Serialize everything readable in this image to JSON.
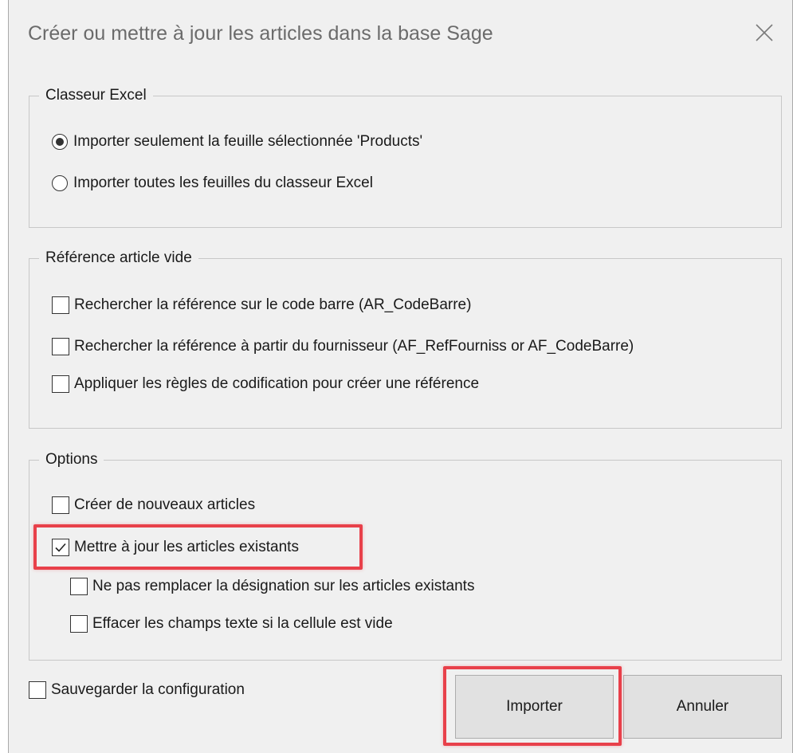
{
  "dialog": {
    "title": "Créer ou mettre à jour les articles dans la base Sage",
    "close_icon": "close-icon"
  },
  "classeur": {
    "legend": "Classeur Excel",
    "options": [
      {
        "label": "Importer seulement la feuille sélectionnée 'Products'",
        "checked": true
      },
      {
        "label": "Importer toutes les feuilles du classeur Excel",
        "checked": false
      }
    ]
  },
  "reference": {
    "legend": "Référence article vide",
    "options": [
      {
        "label": "Rechercher la référence sur le code barre (AR_CodeBarre)",
        "checked": false
      },
      {
        "label": "Rechercher la référence à partir du fournisseur (AF_RefFourniss or AF_CodeBarre)",
        "checked": false
      },
      {
        "label": "Appliquer les règles de codification pour créer une référence",
        "checked": false
      }
    ]
  },
  "options": {
    "legend": "Options",
    "items": [
      {
        "label": "Créer de nouveaux articles",
        "checked": false
      },
      {
        "label": "Mettre à jour les articles existants",
        "checked": true
      },
      {
        "label": "Ne pas remplacer la désignation sur les articles existants",
        "checked": false
      },
      {
        "label": "Effacer les champs texte si la cellule est vide",
        "checked": false
      }
    ]
  },
  "footer": {
    "save_config": {
      "label": "Sauvegarder la configuration",
      "checked": false
    },
    "import_label": "Importer",
    "cancel_label": "Annuler"
  },
  "colors": {
    "highlight": "#e8404a",
    "dialog_bg": "#f0f0f0",
    "button_bg": "#e1e1e1"
  }
}
